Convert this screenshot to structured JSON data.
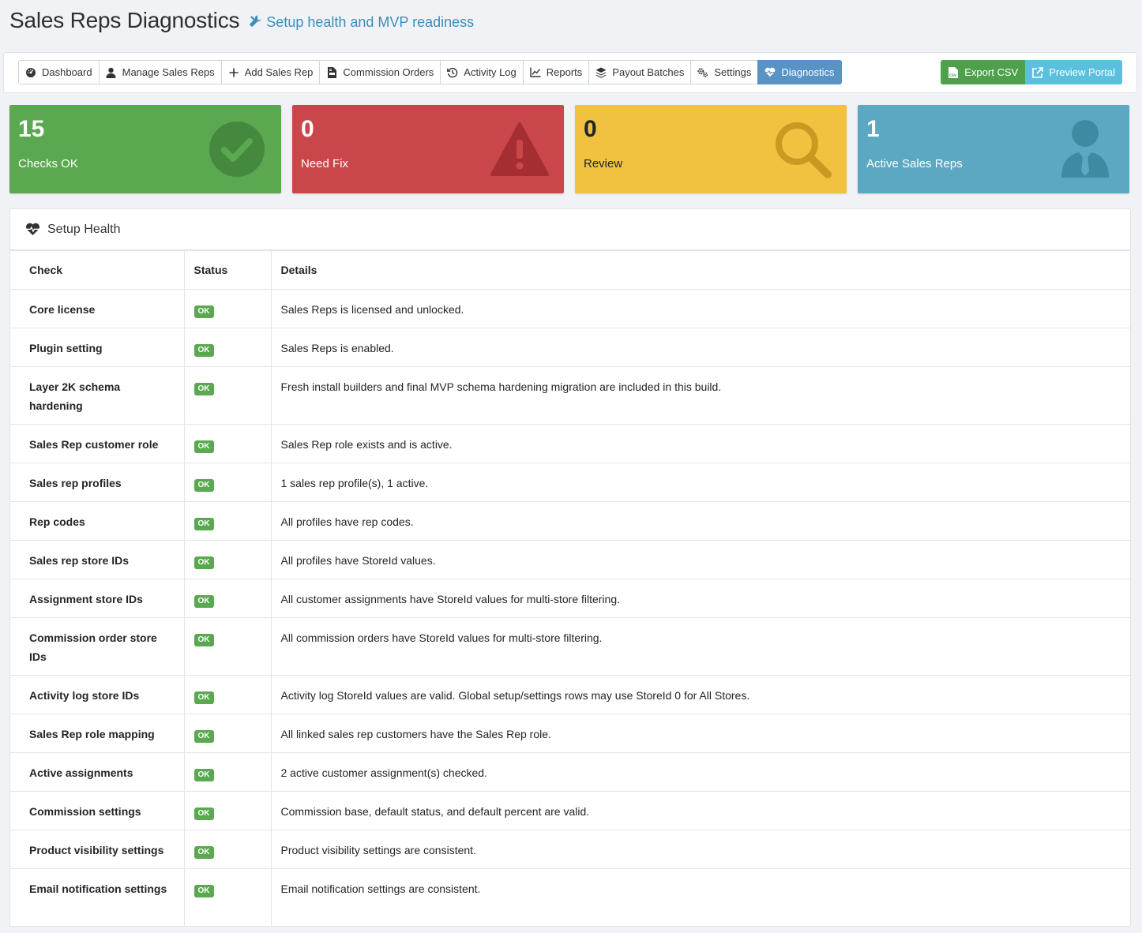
{
  "header": {
    "title": "Sales Reps Diagnostics",
    "subtitle": "Setup health and MVP readiness"
  },
  "nav": {
    "items": [
      {
        "label": "Dashboard",
        "icon": "dashboard-icon"
      },
      {
        "label": "Manage Sales Reps",
        "icon": "user-icon"
      },
      {
        "label": "Add Sales Rep",
        "icon": "plus-icon"
      },
      {
        "label": "Commission Orders",
        "icon": "file-invoice-icon"
      },
      {
        "label": "Activity Log",
        "icon": "history-icon"
      },
      {
        "label": "Reports",
        "icon": "line-chart-icon"
      },
      {
        "label": "Payout Batches",
        "icon": "layers-icon"
      },
      {
        "label": "Settings",
        "icon": "gears-icon"
      },
      {
        "label": "Diagnostics",
        "icon": "heartbeat-icon",
        "active": true
      }
    ],
    "export_label": "Export CSV",
    "preview_label": "Preview Portal"
  },
  "stats": {
    "ok": {
      "value": "15",
      "label": "Checks OK",
      "color": "#5aa84f"
    },
    "fix": {
      "value": "0",
      "label": "Need Fix",
      "color": "#c9474a"
    },
    "review": {
      "value": "0",
      "label": "Review",
      "color": "#f0c240"
    },
    "reps": {
      "value": "1",
      "label": "Active Sales Reps",
      "color": "#5ba8c2"
    }
  },
  "health": {
    "title": "Setup Health",
    "columns": {
      "check": "Check",
      "status": "Status",
      "details": "Details"
    },
    "rows": [
      {
        "check": "Core license",
        "status": "OK",
        "details": "Sales Reps is licensed and unlocked."
      },
      {
        "check": "Plugin setting",
        "status": "OK",
        "details": "Sales Reps is enabled."
      },
      {
        "check": "Layer 2K schema hardening",
        "status": "OK",
        "details": "Fresh install builders and final MVP schema hardening migration are included in this build."
      },
      {
        "check": "Sales Rep customer role",
        "status": "OK",
        "details": "Sales Rep role exists and is active."
      },
      {
        "check": "Sales rep profiles",
        "status": "OK",
        "details": "1 sales rep profile(s), 1 active."
      },
      {
        "check": "Rep codes",
        "status": "OK",
        "details": "All profiles have rep codes."
      },
      {
        "check": "Sales rep store IDs",
        "status": "OK",
        "details": "All profiles have StoreId values."
      },
      {
        "check": "Assignment store IDs",
        "status": "OK",
        "details": "All customer assignments have StoreId values for multi-store filtering."
      },
      {
        "check": "Commission order store IDs",
        "status": "OK",
        "details": "All commission orders have StoreId values for multi-store filtering."
      },
      {
        "check": "Activity log store IDs",
        "status": "OK",
        "details": "Activity log StoreId values are valid. Global setup/settings rows may use StoreId 0 for All Stores."
      },
      {
        "check": "Sales Rep role mapping",
        "status": "OK",
        "details": "All linked sales rep customers have the Sales Rep role."
      },
      {
        "check": "Active assignments",
        "status": "OK",
        "details": "2 active customer assignment(s) checked."
      },
      {
        "check": "Commission settings",
        "status": "OK",
        "details": "Commission base, default status, and default percent are valid."
      },
      {
        "check": "Product visibility settings",
        "status": "OK",
        "details": "Product visibility settings are consistent."
      },
      {
        "check": "Email notification settings",
        "status": "OK",
        "details": "Email notification settings are consistent."
      }
    ]
  }
}
